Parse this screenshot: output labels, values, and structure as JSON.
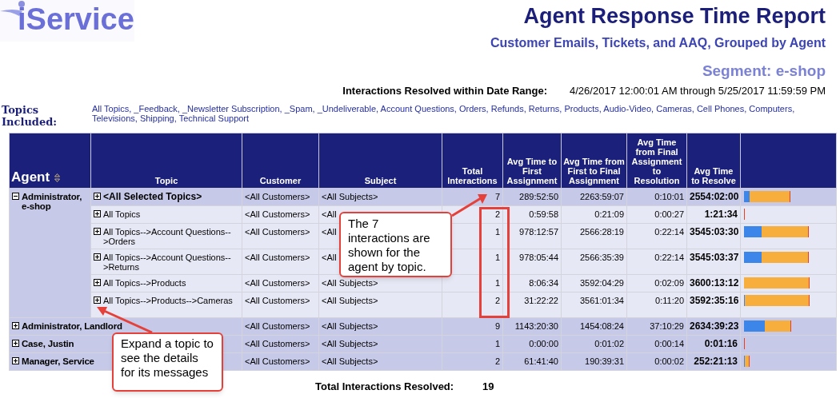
{
  "logo": {
    "text": "iService"
  },
  "title": "Agent Response Time Report",
  "subtitle": "Customer Emails, Tickets, and AAQ, Grouped by Agent",
  "segment": "Segment: e-shop",
  "date_range": {
    "label": "Interactions Resolved within Date Range:",
    "value": "4/26/2017 12:00:01 AM through 5/25/2017 11:59:59 PM"
  },
  "topics_included": {
    "label": "Topics Included:",
    "value": "All Topics, _Feedback, _Newsletter Subscription, _Spam, _Undeliverable, Account Questions, Orders, Refunds, Returns, Products, Audio-Video, Cameras, Cell Phones, Computers, Televisions, Shipping, Technical Support"
  },
  "table": {
    "columns": [
      "Agent",
      "Topic",
      "Customer",
      "Subject",
      "Total Interactions",
      "Avg Time to First Assignment",
      "Avg Time from First to Final Assignment",
      "Avg Time from Final Assignment to Resolution",
      "Avg Time to Resolve"
    ],
    "agents": [
      {
        "name": "Administrator, e-shop",
        "expanded": true,
        "summary": {
          "topic": "<All Selected Topics>",
          "expanded": false,
          "customer": "<All Customers>",
          "subject": "<All Subjects>",
          "total": "7",
          "to_first": "289:52:50",
          "first_to_final": "2263:59:07",
          "final_to_resolution": "0:10:01",
          "to_resolve": "2554:02:00"
        },
        "topics": [
          {
            "topic": "All Topics",
            "expanded": false,
            "customer": "<All Customers>",
            "subject": "<All",
            "total": "2",
            "to_first": "0:59:58",
            "first_to_final": "0:21:09",
            "final_to_resolution": "0:00:27",
            "to_resolve": "1:21:34"
          },
          {
            "topic": "All Topics-->Account Questions-->Orders",
            "expanded": false,
            "customer": "<All Customers>",
            "subject": "<All",
            "total": "1",
            "to_first": "978:12:57",
            "first_to_final": "2566:28:19",
            "final_to_resolution": "0:22:14",
            "to_resolve": "3545:03:30"
          },
          {
            "topic": "All Topics-->Account Questions-->Returns",
            "expanded": false,
            "customer": "<All Customers>",
            "subject": "<All",
            "total": "1",
            "to_first": "978:05:44",
            "first_to_final": "2566:35:39",
            "final_to_resolution": "0:22:14",
            "to_resolve": "3545:03:37"
          },
          {
            "topic": "All Topics-->Products",
            "expanded": false,
            "customer": "<All Customers>",
            "subject": "<All Subjects>",
            "total": "1",
            "to_first": "8:06:34",
            "first_to_final": "3592:04:29",
            "final_to_resolution": "0:02:09",
            "to_resolve": "3600:13:12"
          },
          {
            "topic": "All Topics-->Products-->Cameras",
            "expanded": false,
            "customer": "<All Customers>",
            "subject": "<All Subjects>",
            "total": "2",
            "to_first": "31:22:22",
            "first_to_final": "3561:01:34",
            "final_to_resolution": "0:11:20",
            "to_resolve": "3592:35:16"
          }
        ]
      },
      {
        "name": "Administrator, Landlord",
        "expanded": false,
        "summary": {
          "customer": "<All Customers>",
          "subject": "<All Subjects>",
          "total": "9",
          "to_first": "1143:20:30",
          "first_to_final": "1454:08:24",
          "final_to_resolution": "37:10:29",
          "to_resolve": "2634:39:23"
        }
      },
      {
        "name": "Case, Justin",
        "expanded": false,
        "summary": {
          "customer": "<All Customers>",
          "subject": "<All Subjects>",
          "total": "1",
          "to_first": "0:00:00",
          "first_to_final": "0:01:02",
          "final_to_resolution": "0:00:14",
          "to_resolve": "0:01:16"
        }
      },
      {
        "name": "Manager, Service",
        "expanded": false,
        "summary": {
          "customer": "<All Customers>",
          "subject": "<All Subjects>",
          "total": "2",
          "to_first": "61:41:40",
          "first_to_final": "190:39:31",
          "final_to_resolution": "0:00:02",
          "to_resolve": "252:21:13"
        }
      }
    ]
  },
  "total": {
    "label": "Total Interactions Resolved:",
    "value": "19"
  },
  "callouts": [
    {
      "text": "The 7 interactions are shown for the agent by topic."
    },
    {
      "text": "Expand a topic to see the details for its messages"
    }
  ]
}
